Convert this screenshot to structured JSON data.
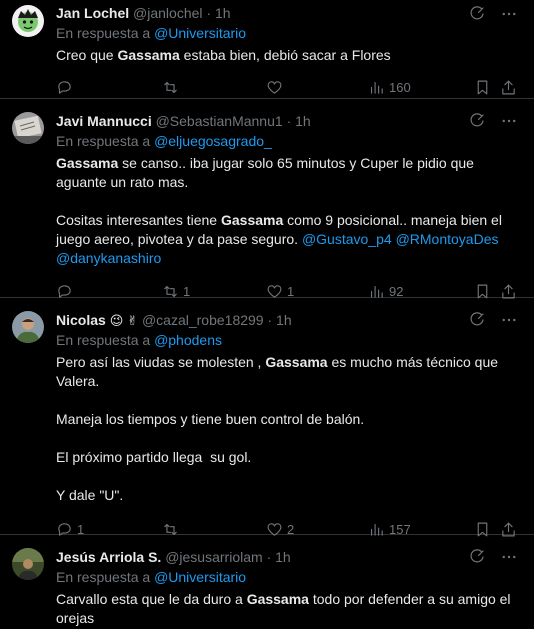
{
  "reply_prefix": "En respuesta a",
  "tweets": [
    {
      "name": "Jan Lochel",
      "handle": "@janlochel",
      "time": "1h",
      "reply_to": "@Universitario",
      "body_parts": [
        "Creo que ",
        "Gassama",
        " estaba bien, debió sacar a Flores"
      ],
      "replies": "",
      "retweets": "",
      "likes": "",
      "views": "160"
    },
    {
      "name": "Javi Mannucci",
      "handle": "@SebastianMannu1",
      "time": "1h",
      "reply_to": "@eljuegosagrado_",
      "p1_parts": [
        "Gassama",
        " se canso.. iba jugar solo 65 minutos y Cuper le pidio que aguante un rato mas."
      ],
      "p2_parts": [
        "Cositas interesantes tiene ",
        "Gassama",
        " como 9 posicional.. maneja bien el juego aereo, pivotea y da pase seguro. "
      ],
      "mentions": [
        "@Gustavo_p4",
        "@RMontoyaDes",
        "@danykanashiro"
      ],
      "replies": "",
      "retweets": "1",
      "likes": "1",
      "views": "92"
    },
    {
      "name": "Nicolas",
      "emojis": [
        "😉",
        "✌"
      ],
      "handle": "@cazal_robe18299",
      "time": "1h",
      "reply_to": "@phodens",
      "p1_parts": [
        "Pero así las viudas se molesten , ",
        "Gassama",
        " es mucho más técnico que Valera."
      ],
      "p2": "Maneja los tiempos y tiene buen control de balón.",
      "p3": "El próximo partido llega  su gol.",
      "p4": "Y dale \"U\".",
      "replies": "1",
      "retweets": "",
      "likes": "2",
      "views": "157"
    },
    {
      "name": "Jesús Arriola S.",
      "handle": "@jesusarriolam",
      "time": "1h",
      "reply_to": "@Universitario",
      "body_parts": [
        "Carvallo esta que le da duro a ",
        "Gassama",
        " todo por defender a su amigo el orejas"
      ]
    }
  ],
  "icons": {
    "grok": "grok-icon",
    "more": "more-icon",
    "reply": "reply-icon",
    "retweet": "retweet-icon",
    "like": "like-icon",
    "views": "views-icon",
    "bookmark": "bookmark-icon",
    "share": "share-icon"
  },
  "colors": {
    "background": "#000000",
    "text": "#e7e9ea",
    "muted": "#71767b",
    "link": "#1d9bf0",
    "divider": "#2f3336"
  }
}
